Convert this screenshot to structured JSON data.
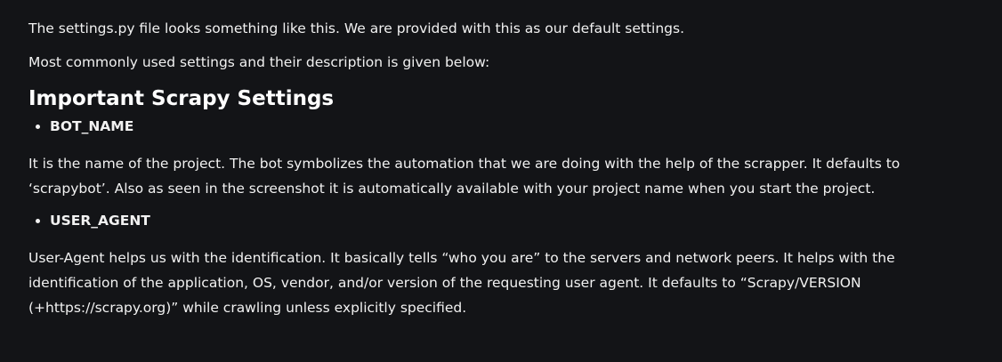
{
  "intro": {
    "line1": "The settings.py file looks something like this. We are provided with this as our default settings.",
    "line2": "Most commonly used settings and their description is given below:"
  },
  "section": {
    "heading": "Important Scrapy Settings"
  },
  "settings": [
    {
      "name": "BOT_NAME",
      "description": "It is the name of the project. The bot symbolizes the automation that we are doing with the help of the scrapper. It defaults to ‘scrapybot’. Also as seen in the screenshot it is automatically available with your project name when you start the project."
    },
    {
      "name": "USER_AGENT",
      "description": "User-Agent helps us with the identification. It basically tells “who you are” to the servers and network peers. It helps with the identification of the application, OS, vendor, and/or version of the requesting user agent. It defaults to “Scrapy/VERSION (+https://scrapy.org)” while crawling unless explicitly specified."
    }
  ]
}
